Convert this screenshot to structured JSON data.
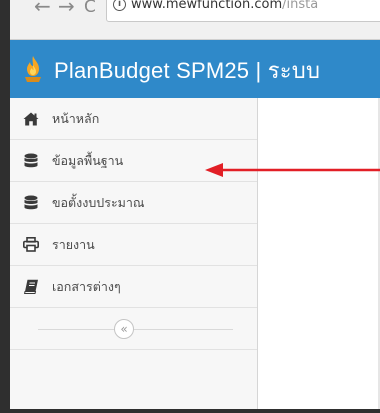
{
  "browser": {
    "url_host": "www.mewfunction.com",
    "url_path": "/insta"
  },
  "header": {
    "title": "PlanBudget SPM25 | ระบบ"
  },
  "sidebar": {
    "items": [
      {
        "label": "หน้าหลัก",
        "icon": "home-icon"
      },
      {
        "label": "ข้อมูลพื้นฐาน",
        "icon": "database-icon"
      },
      {
        "label": "ขอตั้งงบประมาณ",
        "icon": "database-icon"
      },
      {
        "label": "รายงาน",
        "icon": "print-icon"
      },
      {
        "label": "เอกสารต่างๆ",
        "icon": "book-icon"
      }
    ],
    "collapse_glyph": "«"
  },
  "colors": {
    "header_bg": "#2f89c9",
    "annotation_arrow": "#e21f26",
    "sidebar_bg": "#f7f7f7"
  }
}
